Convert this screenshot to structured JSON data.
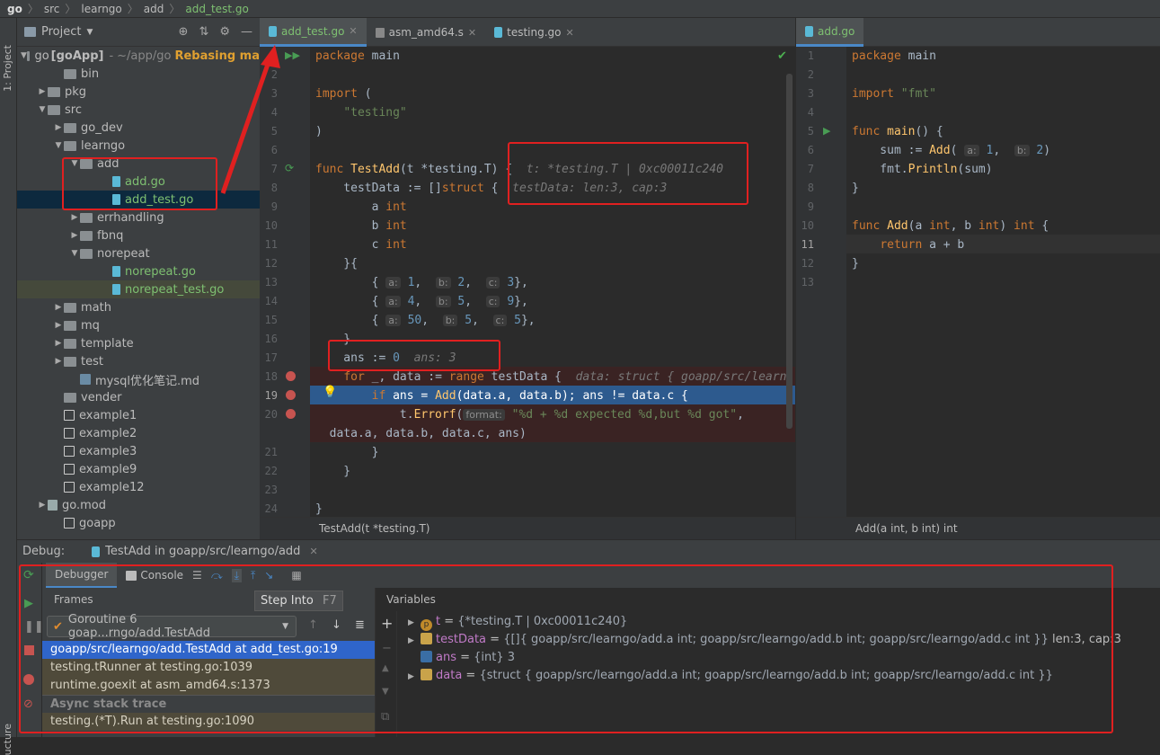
{
  "breadcrumb": [
    "go",
    "src",
    "learngo",
    "add",
    "add_test.go"
  ],
  "sidebar": {
    "project_tab": "1: Project",
    "structure_tab": "ucture"
  },
  "project": {
    "title": "Project",
    "root_name": "go",
    "root_module": "[goApp]",
    "root_path": "~/app/go",
    "root_status": "Rebasing ma",
    "items": [
      {
        "label": "bin",
        "indent": 2,
        "type": "folder",
        "arrow": ""
      },
      {
        "label": "pkg",
        "indent": 1,
        "type": "folder",
        "arrow": "▶"
      },
      {
        "label": "src",
        "indent": 1,
        "type": "folder",
        "arrow": "▼"
      },
      {
        "label": "go_dev",
        "indent": 2,
        "type": "folder",
        "arrow": "▶"
      },
      {
        "label": "learngo",
        "indent": 2,
        "type": "folder",
        "arrow": "▼"
      },
      {
        "label": "add",
        "indent": 3,
        "type": "folder",
        "arrow": "▼"
      },
      {
        "label": "add.go",
        "indent": 5,
        "type": "go",
        "arrow": "",
        "color": "green"
      },
      {
        "label": "add_test.go",
        "indent": 5,
        "type": "go",
        "arrow": "",
        "color": "green",
        "state": "sel"
      },
      {
        "label": "errhandling",
        "indent": 3,
        "type": "folder",
        "arrow": "▶"
      },
      {
        "label": "fbnq",
        "indent": 3,
        "type": "folder",
        "arrow": "▶"
      },
      {
        "label": "norepeat",
        "indent": 3,
        "type": "folder",
        "arrow": "▼"
      },
      {
        "label": "norepeat.go",
        "indent": 5,
        "type": "go",
        "arrow": "",
        "color": "green"
      },
      {
        "label": "norepeat_test.go",
        "indent": 5,
        "type": "go",
        "arrow": "",
        "color": "green",
        "state": "hl"
      },
      {
        "label": "math",
        "indent": 2,
        "type": "folder",
        "arrow": "▶"
      },
      {
        "label": "mq",
        "indent": 2,
        "type": "folder",
        "arrow": "▶"
      },
      {
        "label": "template",
        "indent": 2,
        "type": "folder",
        "arrow": "▶"
      },
      {
        "label": "test",
        "indent": 2,
        "type": "folder",
        "arrow": "▶"
      },
      {
        "label": "mysql优化笔记.md",
        "indent": 3,
        "type": "md",
        "arrow": ""
      },
      {
        "label": "vender",
        "indent": 2,
        "type": "folder",
        "arrow": ""
      },
      {
        "label": "example1",
        "indent": 2,
        "type": "txt",
        "arrow": ""
      },
      {
        "label": "example2",
        "indent": 2,
        "type": "txt",
        "arrow": ""
      },
      {
        "label": "example3",
        "indent": 2,
        "type": "txt",
        "arrow": ""
      },
      {
        "label": "example9",
        "indent": 2,
        "type": "txt",
        "arrow": ""
      },
      {
        "label": "example12",
        "indent": 2,
        "type": "txt",
        "arrow": ""
      },
      {
        "label": "go.mod",
        "indent": 1,
        "type": "mod",
        "arrow": "▶"
      },
      {
        "label": "goapp",
        "indent": 2,
        "type": "txt",
        "arrow": ""
      }
    ]
  },
  "editor1": {
    "tabs": [
      {
        "label": "add_test.go",
        "active": true
      },
      {
        "label": "asm_amd64.s"
      },
      {
        "label": "testing.go"
      }
    ],
    "status": "TestAdd(t *testing.T)"
  },
  "editor2": {
    "tabs": [
      {
        "label": "add.go",
        "active": true
      }
    ],
    "status": "Add(a int, b int) int"
  },
  "debug": {
    "label": "Debug:",
    "session": "TestAdd in goapp/src/learngo/add",
    "tabs": {
      "debugger": "Debugger",
      "console": "Console"
    },
    "frames_title": "Frames",
    "variables_title": "Variables",
    "tooltip": {
      "label": "Step Into",
      "shortcut": "F7"
    },
    "goroutine": "Goroutine 6 goap...rngo/add.TestAdd",
    "frames": [
      "goapp/src/learngo/add.TestAdd at add_test.go:19",
      "testing.tRunner at testing.go:1039",
      "runtime.goexit at asm_amd64.s:1373"
    ],
    "async_label": "Async stack trace",
    "async_frames": [
      "testing.(*T).Run at testing.go:1090"
    ],
    "variables": [
      {
        "name": "t",
        "value": "{*testing.T | 0xc00011c240}",
        "icon": "p",
        "arrow": "▶"
      },
      {
        "name": "testData",
        "value": "{[]{ goapp/src/learngo/add.a int; goapp/src/learngo/add.b int; goapp/src/learngo/add.c int }}",
        "extra": "len:3, cap:3",
        "icon": "list",
        "arrow": "▶"
      },
      {
        "name": "ans",
        "value": "{int} 3",
        "icon": "int",
        "arrow": ""
      },
      {
        "name": "data",
        "value": "{struct { goapp/src/learngo/add.a int; goapp/src/learngo/add.b int; goapp/src/learngo/add.c int }}",
        "icon": "list",
        "arrow": "▶"
      }
    ]
  },
  "colors": {
    "annotation": "#e02020",
    "selection": "#2d5a8e",
    "breakpoint": "#c75450"
  }
}
